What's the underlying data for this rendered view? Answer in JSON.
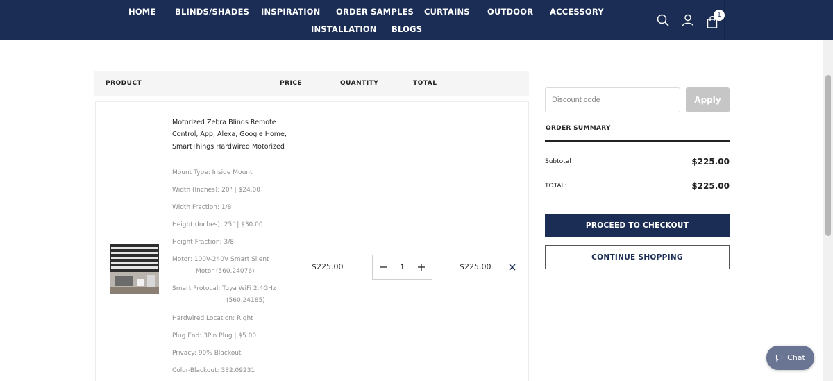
{
  "nav": {
    "items": [
      "HOME",
      "BLINDS/SHADES",
      "INSPIRATION",
      "ORDER SAMPLES",
      "CURTAINS",
      "OUTDOOR",
      "ACCESSORY",
      "INSTALLATION",
      "BLOGS"
    ],
    "cart_count": "1",
    "icons": [
      "search-icon",
      "user-icon",
      "bag-icon"
    ]
  },
  "table": {
    "headers": {
      "product": "PRODUCT",
      "price": "PRICE",
      "quantity": "QUANTITY",
      "total": "TOTAL"
    }
  },
  "item": {
    "title": "Motorized Zebra Blinds Remote Control, App, Alexa, Google Home, SmartThings Hardwired Motorized",
    "options": [
      {
        "text": "Mount Type: Inside Mount"
      },
      {
        "text": "Width (Inches): 20\" | $24.00"
      },
      {
        "text": "Width Fraction: 1/8"
      },
      {
        "text": "Height (Inches): 25\" | $30.00"
      },
      {
        "text": "Height Fraction: 3/8"
      },
      {
        "text": "Motor: 100V-240V Smart Silent",
        "cont": "Motor (560.24076)"
      },
      {
        "text": "Smart Protocal: Tuya WiFi 2.4GHz",
        "cont": "(560.24185)"
      },
      {
        "text": "Hardwired Location: Right"
      },
      {
        "text": "Plug End: 3Pin Plug | $5.00"
      },
      {
        "text": "Privacy: 90% Blackout"
      },
      {
        "text": "Color-Blackout: 332.09231"
      }
    ],
    "price": "$225.00",
    "quantity": "1",
    "total": "$225.00"
  },
  "summary": {
    "discount_placeholder": "Discount code",
    "apply_label": "Apply",
    "title": "ORDER SUMMARY",
    "subtotal_label": "Subtotal",
    "subtotal_value": "$225.00",
    "total_label": "TOTAL:",
    "total_value": "$225.00",
    "checkout_label": "PROCEED TO CHECKOUT",
    "continue_label": "CONTINUE SHOPPING"
  },
  "chat": {
    "label": "Chat"
  },
  "colors": {
    "brand": "#1b2d55",
    "apply_disabled": "#c6c6c6",
    "chat_bg": "#6a7594"
  }
}
